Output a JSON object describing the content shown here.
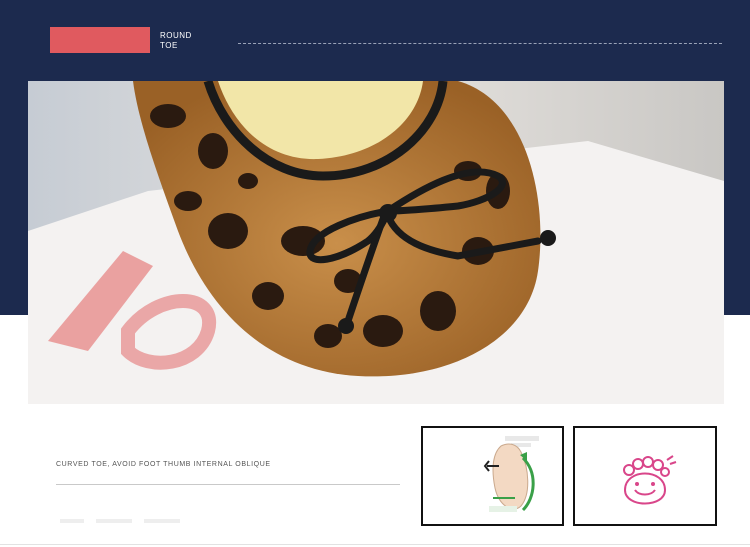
{
  "header": {
    "section_label_line1": "ROUND",
    "section_label_line2": "TOE",
    "accent_color": "#e05a5f",
    "band_color": "#1c2a4e"
  },
  "photo": {
    "subject": "leopard-print-flat-shoe-with-bow"
  },
  "feature": {
    "caption": "CURVED TOE, AVOID FOOT THUMB INTERNAL OBLIQUE"
  },
  "thumbnails": [
    {
      "icon": "foot-toe-diagram-icon"
    },
    {
      "icon": "smiling-foot-icon"
    }
  ]
}
